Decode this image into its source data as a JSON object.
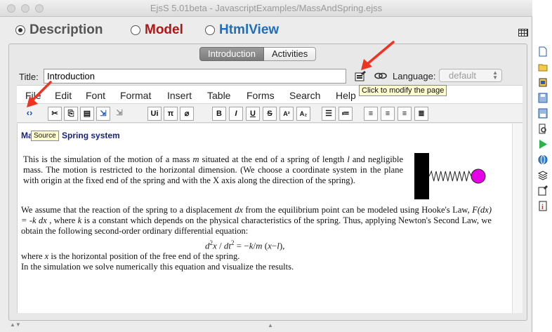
{
  "window": {
    "title": "EjsS 5.01beta - JavascriptExamples/MassAndSpring.ejss"
  },
  "modes": [
    {
      "label": "Description",
      "color": "#555555",
      "selected": true
    },
    {
      "label": "Model",
      "color": "#b01616",
      "selected": false
    },
    {
      "label": "HtmlView",
      "color": "#1c6fc0",
      "selected": false
    }
  ],
  "tabs": [
    "Introduction",
    "Activities"
  ],
  "page": {
    "title_label": "Title:",
    "title_value": "Introduction",
    "language_label": "Language:",
    "language_value": "default"
  },
  "menu": [
    "File",
    "Edit",
    "Font",
    "Format",
    "Insert",
    "Table",
    "Forms",
    "Search",
    "Help"
  ],
  "toolbar": {
    "source_icon": "source-code-icon",
    "buttons": [
      "cut",
      "copy",
      "paste",
      "paste-special",
      "clear",
      "unicode",
      "pi",
      "no-paint",
      "B",
      "I",
      "U",
      "S",
      "A²",
      "A₂",
      "bullet-list",
      "numbered-list",
      "align-left",
      "align-center",
      "align-right",
      "justify"
    ]
  },
  "tooltips": {
    "source": "Source",
    "modify": "Click to modify the page"
  },
  "doc": {
    "heading": "Mass and Spring system",
    "para1": [
      {
        "t": "This is the simulation of the motion of a mass "
      },
      {
        "t": "m",
        "i": true
      },
      {
        "t": " situated at the end of a spring of length "
      },
      {
        "t": "l",
        "i": true
      },
      {
        "t": " and negligible mass. The motion is restricted to the horizontal dimension. (We choose a coordinate system in the plane with origin at the fixed end of the spring and with the X axis along the direction of the spring)."
      }
    ],
    "para2": [
      {
        "t": "We assume that the reaction of the spring to a displacement "
      },
      {
        "t": "dx",
        "i": true
      },
      {
        "t": " from the equilibrium point can be modeled using Hooke's Law, "
      },
      {
        "t": "F(dx) = -k dx",
        "i": true
      },
      {
        "t": " , where "
      },
      {
        "t": "k",
        "i": true
      },
      {
        "t": " is a constant which depends on the physical characteristics of the spring. Thus, applying Newton's Second Law, we obtain the following second-order ordinary differential equation:"
      }
    ],
    "equation": "d²x / dt² = −k/m (x−l),",
    "para3_line1": [
      {
        "t": "where "
      },
      {
        "t": "x",
        "i": true
      },
      {
        "t": " is the horizontal position of the free end of the spring."
      }
    ],
    "para3_line2": "In the simulation we solve numerically this equation and visualize the results."
  },
  "colors": {
    "arrow": "#ee3322",
    "ball": "#e600e6",
    "heading": "#1a237e"
  }
}
